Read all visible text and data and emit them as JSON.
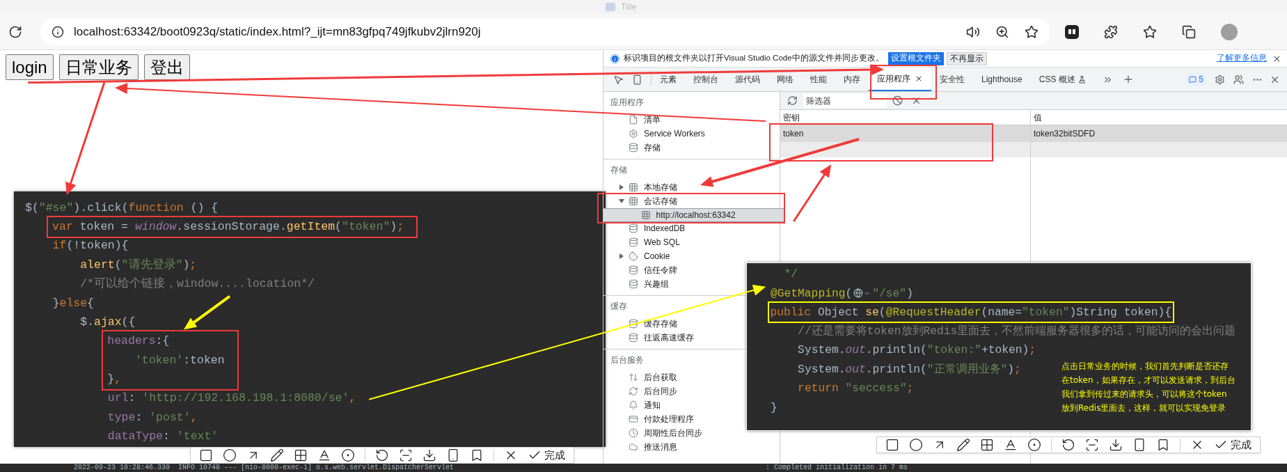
{
  "window": {
    "title": "Title"
  },
  "address_bar": {
    "url": "localhost:63342/boot0923q/static/index.html?_ijt=mn83gfpq749jfkubv2jlrn920j"
  },
  "page_buttons": [
    "login",
    "日常业务",
    "登出"
  ],
  "code_left": [
    [
      {
        "kind": "plain",
        "text": "$("
      },
      {
        "kind": "str",
        "text": "\"#se\""
      },
      {
        "kind": "plain",
        "text": ").click("
      },
      {
        "kind": "kw",
        "text": "function"
      },
      {
        "kind": "plain",
        "text": " () {"
      }
    ],
    [
      {
        "kind": "kw",
        "text": "    var"
      },
      {
        "kind": "plain",
        "text": " token = "
      },
      {
        "kind": "global",
        "text": "window"
      },
      {
        "kind": "plain",
        "text": ".sessionStorage."
      },
      {
        "kind": "fn",
        "text": "getItem"
      },
      {
        "kind": "plain",
        "text": "("
      },
      {
        "kind": "str",
        "text": "\"token\""
      },
      {
        "kind": "plain",
        "text": ")"
      },
      {
        "kind": "kw",
        "text": ";"
      }
    ],
    [
      {
        "kind": "kw",
        "text": "    if"
      },
      {
        "kind": "plain",
        "text": "(!token){"
      }
    ],
    [
      {
        "kind": "fn",
        "text": "        alert"
      },
      {
        "kind": "plain",
        "text": "("
      },
      {
        "kind": "str",
        "text": "\"请先登录\""
      },
      {
        "kind": "plain",
        "text": ")"
      },
      {
        "kind": "kw",
        "text": ";"
      }
    ],
    [
      {
        "kind": "comment",
        "text": "        /*可以给个链接，window....location*/"
      }
    ],
    [
      {
        "kind": "plain",
        "text": "    }"
      },
      {
        "kind": "kw",
        "text": "else"
      },
      {
        "kind": "plain",
        "text": "{"
      }
    ],
    [
      {
        "kind": "plain",
        "text": "        $."
      },
      {
        "kind": "fn",
        "text": "ajax"
      },
      {
        "kind": "plain",
        "text": "({"
      }
    ],
    [
      {
        "kind": "prop",
        "text": "            headers"
      },
      {
        "kind": "plain",
        "text": ":{"
      }
    ],
    [
      {
        "kind": "str",
        "text": "                'token'"
      },
      {
        "kind": "plain",
        "text": ":token"
      }
    ],
    [
      {
        "kind": "plain",
        "text": "            }"
      },
      {
        "kind": "kw",
        "text": ","
      }
    ],
    [
      {
        "kind": "prop",
        "text": "            url"
      },
      {
        "kind": "plain",
        "text": ": "
      },
      {
        "kind": "str",
        "text": "'http://192.168.198.1:8080/se'"
      },
      {
        "kind": "kw",
        "text": ","
      }
    ],
    [
      {
        "kind": "prop",
        "text": "            type"
      },
      {
        "kind": "plain",
        "text": ": "
      },
      {
        "kind": "str",
        "text": "'post'"
      },
      {
        "kind": "kw",
        "text": ","
      }
    ],
    [
      {
        "kind": "prop",
        "text": "            dataType"
      },
      {
        "kind": "plain",
        "text": ": "
      },
      {
        "kind": "str",
        "text": "'text'"
      }
    ]
  ],
  "devtools": {
    "info_bar": {
      "message": "标识项目的根文件夹以打开Visual Studio Code中的源文件并同步更改。",
      "primary_button": "设置根文件夹",
      "secondary_button": "不再显示",
      "link": "了解更多信息"
    },
    "tabs": [
      {
        "label": "元素",
        "selected": false,
        "kind": "plain"
      },
      {
        "label": "控制台",
        "selected": false,
        "kind": "plain"
      },
      {
        "label": "源代码",
        "selected": false,
        "kind": "plain"
      },
      {
        "label": "网络",
        "selected": false,
        "kind": "plain"
      },
      {
        "label": "性能",
        "selected": false,
        "kind": "plain"
      },
      {
        "label": "内存",
        "selected": false,
        "kind": "plain"
      },
      {
        "label": "应用程序",
        "selected": true,
        "kind": "plain"
      },
      {
        "label": "安全性",
        "selected": false,
        "kind": "plain"
      },
      {
        "label": "Lighthouse",
        "selected": false,
        "kind": "plain"
      },
      {
        "label": "CSS 概述",
        "selected": false,
        "kind": "experimental"
      }
    ],
    "issues_count": "5",
    "sidebar": [
      {
        "title": "应用程序",
        "items": [
          {
            "label": "清单",
            "kind": "manifest",
            "selected": false
          },
          {
            "label": "Service Workers",
            "kind": "worker",
            "selected": false
          },
          {
            "label": "存储",
            "kind": "storage",
            "selected": false
          }
        ]
      },
      {
        "title": "存储",
        "items": [
          {
            "label": "本地存储",
            "kind": "table",
            "selected": false,
            "expanded": false
          },
          {
            "label": "会话存储",
            "kind": "table",
            "selected": false,
            "expanded": true,
            "children": [
              {
                "label": "http://localhost:63342",
                "kind": "table",
                "selected": true
              }
            ]
          },
          {
            "label": "IndexedDB",
            "kind": "storage",
            "selected": false
          },
          {
            "label": "Web SQL",
            "kind": "storage",
            "selected": false
          },
          {
            "label": "Cookie",
            "kind": "cookie",
            "selected": false,
            "expanded": false
          },
          {
            "label": "信任令牌",
            "kind": "storage",
            "selected": false
          },
          {
            "label": "兴趣组",
            "kind": "storage",
            "selected": false
          }
        ]
      },
      {
        "title": "缓存",
        "items": [
          {
            "label": "缓存存储",
            "kind": "storage",
            "selected": false
          },
          {
            "label": "往返高速缓存",
            "kind": "storage",
            "selected": false
          }
        ]
      },
      {
        "title": "后台服务",
        "items": [
          {
            "label": "后台获取",
            "kind": "fetch",
            "selected": false
          },
          {
            "label": "后台同步",
            "kind": "sync",
            "selected": false
          },
          {
            "label": "通知",
            "kind": "notification",
            "selected": false
          },
          {
            "label": "付款处理程序",
            "kind": "payment",
            "selected": false
          },
          {
            "label": "周期性后台同步",
            "kind": "periodic",
            "selected": false
          },
          {
            "label": "推送消息",
            "kind": "push",
            "selected": false
          }
        ]
      }
    ],
    "filter": {
      "placeholder": "筛选器"
    },
    "table": {
      "columns": [
        "密钥",
        "值"
      ],
      "rows": [
        {
          "cells": [
            "token",
            "token32bitSDFD"
          ],
          "selected": true
        }
      ]
    }
  },
  "code_right": [
    [
      {
        "kind": "doc",
        "text": "  */"
      }
    ],
    [
      {
        "kind": "anno",
        "text": "@GetMapping"
      },
      {
        "kind": "plain",
        "text": "("
      },
      {
        "kind": "globe"
      },
      {
        "kind": "str",
        "text": "\"/se\""
      },
      {
        "kind": "plain",
        "text": ")"
      }
    ],
    [
      {
        "kind": "kw",
        "text": "public "
      },
      {
        "kind": "plain",
        "text": "Object "
      },
      {
        "kind": "fn",
        "text": "se"
      },
      {
        "kind": "plain",
        "text": "("
      },
      {
        "kind": "anno",
        "text": "@RequestHeader"
      },
      {
        "kind": "plain",
        "text": "(name="
      },
      {
        "kind": "str",
        "text": "\"token\""
      },
      {
        "kind": "plain",
        "text": ")String token){"
      }
    ],
    [
      {
        "kind": "comment",
        "text": "    //还是需要将token放到Redis里面去，不然前端服务器很多的话，可能访问的会出问题"
      }
    ],
    [
      {
        "kind": "plain",
        "text": "    System."
      },
      {
        "kind": "static",
        "text": "out"
      },
      {
        "kind": "plain",
        "text": ".println("
      },
      {
        "kind": "str",
        "text": "\"token:\""
      },
      {
        "kind": "plain",
        "text": "+token)"
      },
      {
        "kind": "kw",
        "text": ";"
      }
    ],
    [
      {
        "kind": "plain",
        "text": "    System."
      },
      {
        "kind": "static",
        "text": "out"
      },
      {
        "kind": "plain",
        "text": ".println("
      },
      {
        "kind": "str",
        "text": "\"正常调用业务\""
      },
      {
        "kind": "plain",
        "text": ")"
      },
      {
        "kind": "kw",
        "text": ";"
      }
    ],
    [
      {
        "kind": "kw",
        "text": "    return "
      },
      {
        "kind": "str",
        "text": "\"seccess\""
      },
      {
        "kind": "kw",
        "text": ";"
      }
    ],
    [
      {
        "kind": "plain",
        "text": "}"
      }
    ]
  ],
  "note": [
    "点击日常业务的时候，我们首先判断是否还存",
    "在token，如果存在，才可以发送请求，到后台",
    "我们拿到传过来的请求头，可以将这个token",
    "放到Redis里面去，这样，就可以实现免登录"
  ],
  "screenshot_toolbars": [
    {
      "done_label": "完成"
    },
    {
      "done_label": "完成"
    }
  ],
  "console": {
    "line": "2022-09-23 10:28:46.330  INFO 10748 --- [nio-8080-exec-1] o.s.web.servlet.DispatcherServlet",
    "message": ": Completed initialization in 7 ms"
  }
}
